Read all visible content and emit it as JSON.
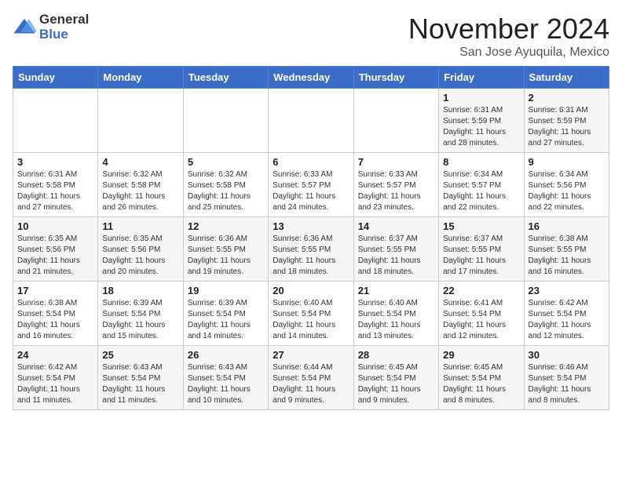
{
  "logo": {
    "general": "General",
    "blue": "Blue"
  },
  "title": "November 2024",
  "location": "San Jose Ayuquila, Mexico",
  "days_of_week": [
    "Sunday",
    "Monday",
    "Tuesday",
    "Wednesday",
    "Thursday",
    "Friday",
    "Saturday"
  ],
  "weeks": [
    [
      {
        "day": "",
        "info": ""
      },
      {
        "day": "",
        "info": ""
      },
      {
        "day": "",
        "info": ""
      },
      {
        "day": "",
        "info": ""
      },
      {
        "day": "",
        "info": ""
      },
      {
        "day": "1",
        "info": "Sunrise: 6:31 AM\nSunset: 5:59 PM\nDaylight: 11 hours\nand 28 minutes."
      },
      {
        "day": "2",
        "info": "Sunrise: 6:31 AM\nSunset: 5:59 PM\nDaylight: 11 hours\nand 27 minutes."
      }
    ],
    [
      {
        "day": "3",
        "info": "Sunrise: 6:31 AM\nSunset: 5:58 PM\nDaylight: 11 hours\nand 27 minutes."
      },
      {
        "day": "4",
        "info": "Sunrise: 6:32 AM\nSunset: 5:58 PM\nDaylight: 11 hours\nand 26 minutes."
      },
      {
        "day": "5",
        "info": "Sunrise: 6:32 AM\nSunset: 5:58 PM\nDaylight: 11 hours\nand 25 minutes."
      },
      {
        "day": "6",
        "info": "Sunrise: 6:33 AM\nSunset: 5:57 PM\nDaylight: 11 hours\nand 24 minutes."
      },
      {
        "day": "7",
        "info": "Sunrise: 6:33 AM\nSunset: 5:57 PM\nDaylight: 11 hours\nand 23 minutes."
      },
      {
        "day": "8",
        "info": "Sunrise: 6:34 AM\nSunset: 5:57 PM\nDaylight: 11 hours\nand 22 minutes."
      },
      {
        "day": "9",
        "info": "Sunrise: 6:34 AM\nSunset: 5:56 PM\nDaylight: 11 hours\nand 22 minutes."
      }
    ],
    [
      {
        "day": "10",
        "info": "Sunrise: 6:35 AM\nSunset: 5:56 PM\nDaylight: 11 hours\nand 21 minutes."
      },
      {
        "day": "11",
        "info": "Sunrise: 6:35 AM\nSunset: 5:56 PM\nDaylight: 11 hours\nand 20 minutes."
      },
      {
        "day": "12",
        "info": "Sunrise: 6:36 AM\nSunset: 5:55 PM\nDaylight: 11 hours\nand 19 minutes."
      },
      {
        "day": "13",
        "info": "Sunrise: 6:36 AM\nSunset: 5:55 PM\nDaylight: 11 hours\nand 18 minutes."
      },
      {
        "day": "14",
        "info": "Sunrise: 6:37 AM\nSunset: 5:55 PM\nDaylight: 11 hours\nand 18 minutes."
      },
      {
        "day": "15",
        "info": "Sunrise: 6:37 AM\nSunset: 5:55 PM\nDaylight: 11 hours\nand 17 minutes."
      },
      {
        "day": "16",
        "info": "Sunrise: 6:38 AM\nSunset: 5:55 PM\nDaylight: 11 hours\nand 16 minutes."
      }
    ],
    [
      {
        "day": "17",
        "info": "Sunrise: 6:38 AM\nSunset: 5:54 PM\nDaylight: 11 hours\nand 16 minutes."
      },
      {
        "day": "18",
        "info": "Sunrise: 6:39 AM\nSunset: 5:54 PM\nDaylight: 11 hours\nand 15 minutes."
      },
      {
        "day": "19",
        "info": "Sunrise: 6:39 AM\nSunset: 5:54 PM\nDaylight: 11 hours\nand 14 minutes."
      },
      {
        "day": "20",
        "info": "Sunrise: 6:40 AM\nSunset: 5:54 PM\nDaylight: 11 hours\nand 14 minutes."
      },
      {
        "day": "21",
        "info": "Sunrise: 6:40 AM\nSunset: 5:54 PM\nDaylight: 11 hours\nand 13 minutes."
      },
      {
        "day": "22",
        "info": "Sunrise: 6:41 AM\nSunset: 5:54 PM\nDaylight: 11 hours\nand 12 minutes."
      },
      {
        "day": "23",
        "info": "Sunrise: 6:42 AM\nSunset: 5:54 PM\nDaylight: 11 hours\nand 12 minutes."
      }
    ],
    [
      {
        "day": "24",
        "info": "Sunrise: 6:42 AM\nSunset: 5:54 PM\nDaylight: 11 hours\nand 11 minutes."
      },
      {
        "day": "25",
        "info": "Sunrise: 6:43 AM\nSunset: 5:54 PM\nDaylight: 11 hours\nand 11 minutes."
      },
      {
        "day": "26",
        "info": "Sunrise: 6:43 AM\nSunset: 5:54 PM\nDaylight: 11 hours\nand 10 minutes."
      },
      {
        "day": "27",
        "info": "Sunrise: 6:44 AM\nSunset: 5:54 PM\nDaylight: 11 hours\nand 9 minutes."
      },
      {
        "day": "28",
        "info": "Sunrise: 6:45 AM\nSunset: 5:54 PM\nDaylight: 11 hours\nand 9 minutes."
      },
      {
        "day": "29",
        "info": "Sunrise: 6:45 AM\nSunset: 5:54 PM\nDaylight: 11 hours\nand 8 minutes."
      },
      {
        "day": "30",
        "info": "Sunrise: 6:46 AM\nSunset: 5:54 PM\nDaylight: 11 hours\nand 8 minutes."
      }
    ]
  ]
}
